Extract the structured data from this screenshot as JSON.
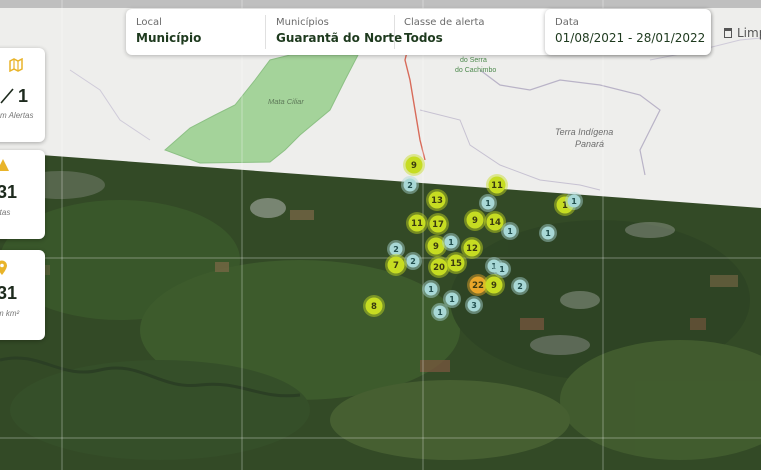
{
  "filters": {
    "local": {
      "label": "Local",
      "value": "Município"
    },
    "municipio": {
      "label": "Municípios",
      "value": "Guarantã do Norte"
    },
    "classe": {
      "label": "Classe de alerta",
      "value": "Todos"
    },
    "data": {
      "label": "Data",
      "value": "01/08/2021 - 28/01/2022"
    },
    "clear_label": "Limp"
  },
  "cards": {
    "alerts": {
      "icon": "map-icon",
      "value": "1",
      "caption": "m Alertas"
    },
    "warnings": {
      "icon": "warning-triangle-icon",
      "value": "31",
      "caption": "rtas"
    },
    "area": {
      "icon": "location-pin-icon",
      "value": "31",
      "caption": "m km²"
    }
  },
  "map_labels": {
    "mata_ciliar": "Mata Ciliar",
    "serra_1": "do Serra",
    "serra_2": "do Cachimbo",
    "terra_1": "Terra Indígena",
    "terra_2": "Panará"
  },
  "clusters": [
    {
      "count": "9",
      "level": "yellow"
    },
    {
      "count": "2",
      "level": "teal"
    },
    {
      "count": "11",
      "level": "yellow"
    },
    {
      "count": "13",
      "level": "yellow"
    },
    {
      "count": "1",
      "level": "teal"
    },
    {
      "count": "1",
      "level": "yellow"
    },
    {
      "count": "1",
      "level": "teal"
    },
    {
      "count": "11",
      "level": "yellow"
    },
    {
      "count": "17",
      "level": "yellow"
    },
    {
      "count": "9",
      "level": "yellow"
    },
    {
      "count": "14",
      "level": "yellow"
    },
    {
      "count": "1",
      "level": "teal"
    },
    {
      "count": "1",
      "level": "teal"
    },
    {
      "count": "2",
      "level": "teal"
    },
    {
      "count": "9",
      "level": "yellow"
    },
    {
      "count": "1",
      "level": "teal"
    },
    {
      "count": "12",
      "level": "yellow"
    },
    {
      "count": "2",
      "level": "teal"
    },
    {
      "count": "7",
      "level": "yellow"
    },
    {
      "count": "20",
      "level": "yellow"
    },
    {
      "count": "15",
      "level": "yellow"
    },
    {
      "count": "1",
      "level": "teal"
    },
    {
      "count": "1",
      "level": "teal"
    },
    {
      "count": "22",
      "level": "orange"
    },
    {
      "count": "9",
      "level": "yellow"
    },
    {
      "count": "2",
      "level": "teal"
    },
    {
      "count": "1",
      "level": "teal"
    },
    {
      "count": "1",
      "level": "teal"
    },
    {
      "count": "3",
      "level": "teal"
    },
    {
      "count": "8",
      "level": "yellow"
    },
    {
      "count": "1",
      "level": "teal"
    }
  ],
  "colors": {
    "yellow": "#c6dc22",
    "teal": "#a8d8d6",
    "orange": "#e9a62a",
    "accent": "#1e3a1e"
  }
}
